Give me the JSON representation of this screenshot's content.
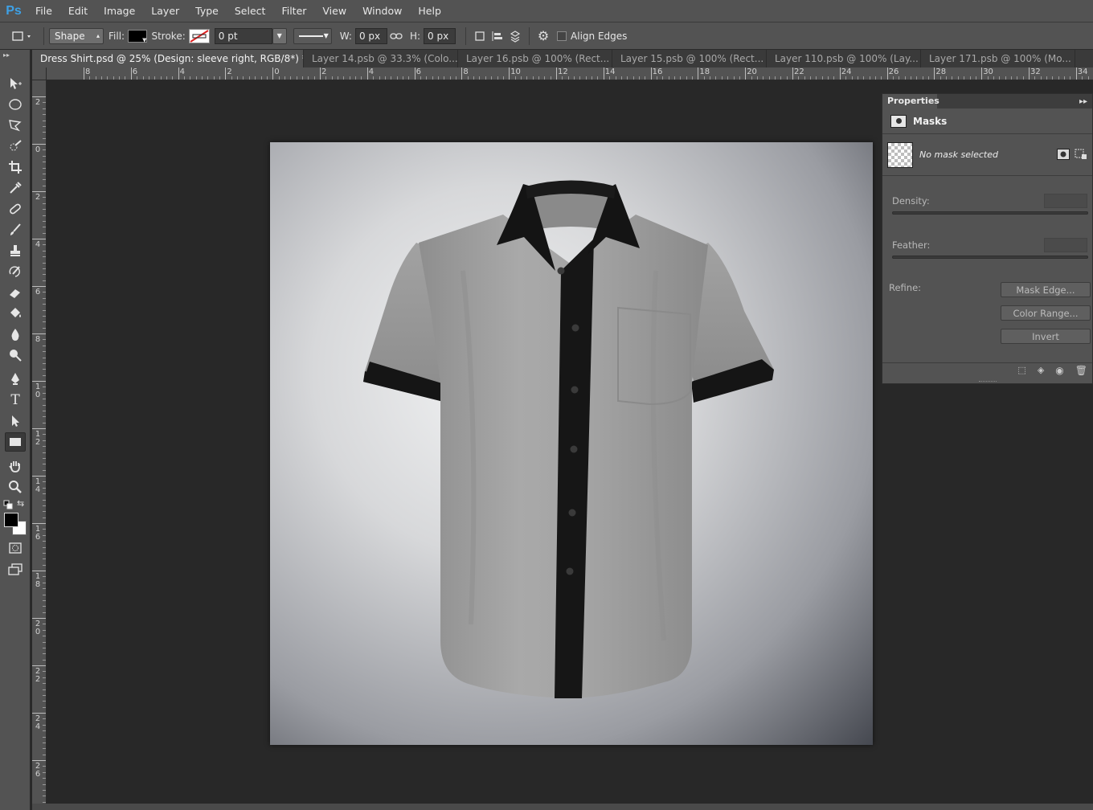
{
  "app": {
    "logo": "Ps"
  },
  "menu": [
    "File",
    "Edit",
    "Image",
    "Layer",
    "Type",
    "Select",
    "Filter",
    "View",
    "Window",
    "Help"
  ],
  "options": {
    "tool_mode": "Shape",
    "fill_label": "Fill:",
    "fill_color": "#000000",
    "stroke_label": "Stroke:",
    "stroke_width": "0 pt",
    "w_label": "W:",
    "w_value": "0 px",
    "h_label": "H:",
    "h_value": "0 px",
    "align_edges": "Align Edges"
  },
  "tabs": [
    {
      "label": "Dress Shirt.psd @ 25% (Design: sleeve right, RGB/8*) *",
      "active": true
    },
    {
      "label": "Layer 14.psb @ 33.3% (Colo...",
      "active": false
    },
    {
      "label": "Layer 16.psb @ 100% (Rect...",
      "active": false
    },
    {
      "label": "Layer 15.psb @ 100% (Rect...",
      "active": false
    },
    {
      "label": "Layer 110.psb @ 100% (Lay...",
      "active": false
    },
    {
      "label": "Layer 171.psb @ 100% (Mo...",
      "active": false
    }
  ],
  "ruler": {
    "top_labels": [
      "8",
      "6",
      "4",
      "2",
      "0",
      "2",
      "4",
      "6",
      "8",
      "10",
      "12",
      "14",
      "16",
      "18",
      "20",
      "22",
      "24",
      "26",
      "28",
      "30",
      "32",
      "34"
    ],
    "left_labels": [
      "2",
      "0",
      "2",
      "4",
      "6",
      "8",
      "10",
      "12",
      "14",
      "16",
      "18",
      "20",
      "22",
      "24",
      "26"
    ]
  },
  "tools": [
    "move-tool-icon",
    "elliptical-marquee-icon",
    "polygonal-lasso-icon",
    "quick-selection-icon",
    "crop-icon",
    "eyedropper-icon",
    "spot-healing-icon",
    "brush-icon",
    "clone-stamp-icon",
    "history-brush-icon",
    "eraser-icon",
    "paint-bucket-icon",
    "blur-icon",
    "dodge-icon",
    "pen-icon",
    "type-icon",
    "path-selection-icon",
    "rectangle-tool-icon",
    "hand-icon",
    "zoom-icon"
  ],
  "properties": {
    "tab": "Properties",
    "section": "Masks",
    "no_mask": "No mask selected",
    "density_label": "Density:",
    "feather_label": "Feather:",
    "refine_label": "Refine:",
    "mask_edge": "Mask Edge...",
    "color_range": "Color Range...",
    "invert": "Invert"
  },
  "colors": {
    "foreground": "#000000",
    "background": "#ffffff",
    "shirt_body": "#9c9c9c",
    "shirt_trim": "#141414"
  }
}
